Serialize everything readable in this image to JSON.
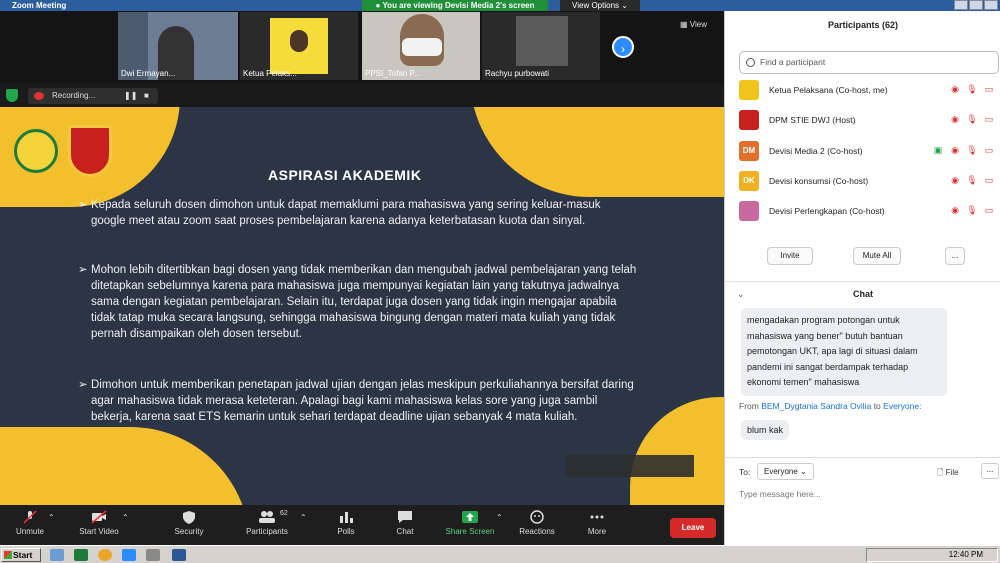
{
  "window": {
    "title": "Zoom Meeting"
  },
  "share_banner": "You are viewing Devisi Media 2's screen",
  "view_options": "View Options",
  "view_button": "View",
  "thumbnails": [
    {
      "name": "Dwi Ermayan..."
    },
    {
      "name": "Ketua Pelaks..."
    },
    {
      "name": "PPSI_Tofan P..."
    },
    {
      "name": "Rachyu purbowati"
    }
  ],
  "recording": {
    "label": "Recording..."
  },
  "slide": {
    "title": "ASPIRASI AKADEMIK",
    "bullet": "➢",
    "paragraphs": [
      "Kepada seluruh dosen dimohon untuk dapat memaklumi para mahasiswa yang sering keluar-masuk google meet atau zoom saat proses pembelajaran karena adanya keterbatasan kuota dan sinyal.",
      "Mohon lebih ditertibkan bagi dosen yang tidak memberikan dan mengubah jadwal pembelajaran yang telah ditetapkan sebelumnya karena para mahasiswa juga mempunyai kegiatan lain yang takutnya jadwalnya sama dengan kegiatan pembelajaran. Selain itu, terdapat juga dosen yang tidak ingin mengajar apabila tidak tatap muka secara langsung, sehingga mahasiswa bingung dengan materi mata kuliah yang tidak pernah disampaikan oleh dosen tersebut.",
      "Dimohon untuk memberikan penetapan jadwal ujian dengan jelas meskipun perkuliahannya bersifat daring agar mahasiswa tidak merasa keteteran. Apalagi bagi kami mahasiswa kelas sore yang juga sambil bekerja, karena saat ETS kemarin untuk sehari terdapat deadline ujian sebanyak 4 mata kuliah."
    ]
  },
  "toolbar": {
    "unmute": "Unmute",
    "start_video": "Start Video",
    "security": "Security",
    "participants": "Participants",
    "participants_count": "62",
    "polls": "Polls",
    "chat": "Chat",
    "share_screen": "Share Screen",
    "reactions": "Reactions",
    "more": "More",
    "leave": "Leave"
  },
  "participants_panel": {
    "title": "Participants (62)",
    "search_placeholder": "Find a participant",
    "list": [
      {
        "name": "Ketua Pelaksana (Co-host, me)",
        "initials": "",
        "color": "#f0c419"
      },
      {
        "name": "DPM STIE DWJ (Host)",
        "initials": "",
        "color": "#c8201d"
      },
      {
        "name": "Devisi Media 2 (Co-host)",
        "initials": "DM",
        "color": "#e0702a"
      },
      {
        "name": "Devisi konsumsi (Co-host)",
        "initials": "DK",
        "color": "#f0b020"
      },
      {
        "name": "Devisi Perlengkapan (Co-host)",
        "initials": "",
        "color": "#c86aa0"
      }
    ],
    "invite": "Invite",
    "mute_all": "Mute All",
    "more": "..."
  },
  "chat_panel": {
    "title": "Chat",
    "message1": "mengadakan program potongan untuk mahasiswa yang bener\" butuh bantuan pemotongan UKT, apa lagi di situasi dalam pandemi ini sangat berdampak terhadap ekonomi temen\" mahasiswa",
    "from_prefix": "From",
    "from_name": "BEM_Dygtania Sandra Ovilia",
    "from_to": "to",
    "from_target": "Everyone:",
    "message2": "blum kak",
    "to_label": "To:",
    "to_value": "Everyone",
    "file": "File",
    "more": "...",
    "input_placeholder": "Type message here..."
  },
  "taskbar": {
    "start": "Start",
    "clock": "12:40 PM"
  },
  "colors": {
    "share_green": "#1f8f3a",
    "leave_red": "#d42a2a",
    "slide_bg": "#2c3545",
    "slide_accent": "#f4bf2c",
    "link_blue": "#1a6fd6"
  }
}
